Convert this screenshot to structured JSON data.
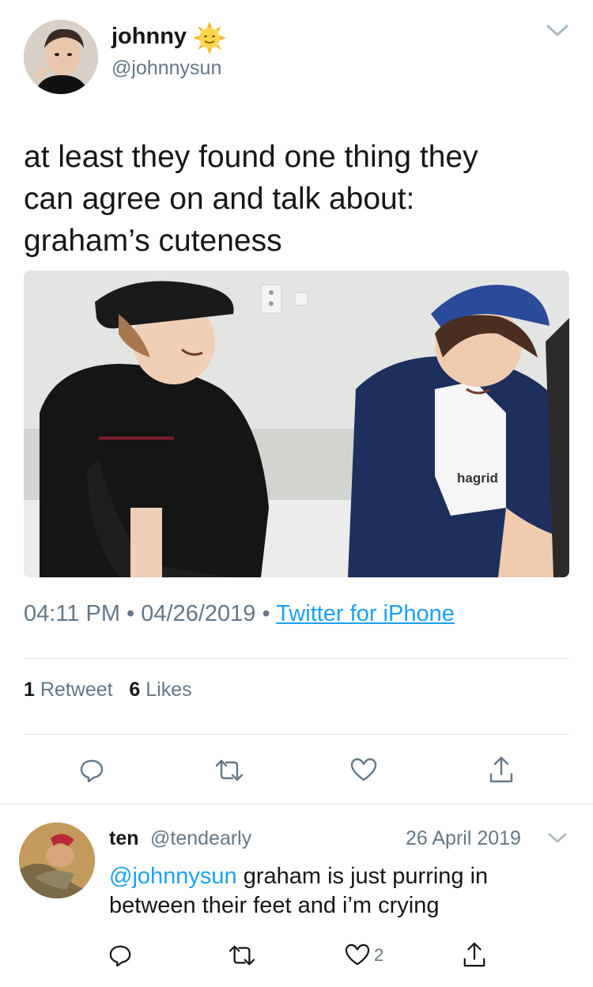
{
  "tweet": {
    "display_name": "johnny",
    "handle": "@johnnysun",
    "text_line1": "at least they found one thing they",
    "text_line2": "can agree on and talk about:",
    "text_line3": "graham’s cuteness",
    "media": {
      "shirt_text": "hagrid"
    },
    "time": "04:11 PM",
    "date": "04/26/2019",
    "separator": "•",
    "source": "Twitter for iPhone",
    "retweet_count": "1",
    "retweet_label": "Retweet",
    "like_count": "6",
    "like_label": "Likes"
  },
  "reply": {
    "display_name": "ten",
    "handle": "@tendearly",
    "date": "26 April 2019",
    "mention": "@johnnysun",
    "text_rest_line1": " graham is just purring in",
    "text_line2": "between their feet and i’m crying",
    "like_count": "2"
  },
  "colors": {
    "link": "#1da1f2",
    "secondary_text": "#657786",
    "divider": "#e1e8ed",
    "primary_text": "#14171a"
  },
  "icons": [
    "sun-emoji",
    "chevron-down-icon",
    "reply-icon",
    "retweet-icon",
    "like-icon",
    "share-icon"
  ]
}
